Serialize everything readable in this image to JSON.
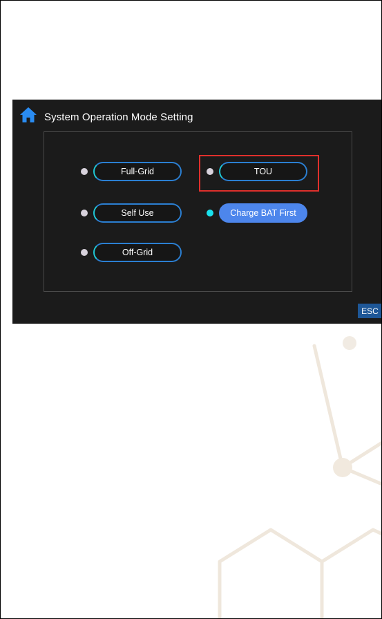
{
  "screen": {
    "title": "System Operation Mode Setting",
    "home_icon": "home-icon",
    "esc_label": "ESC"
  },
  "modes": {
    "full_grid": {
      "label": "Full-Grid",
      "selected": false
    },
    "tou": {
      "label": "TOU",
      "selected": false,
      "highlighted": true
    },
    "self_use": {
      "label": "Self Use",
      "selected": false
    },
    "charge_bat_first": {
      "label": "Charge BAT First",
      "selected": true
    },
    "off_grid": {
      "label": "Off-Grid",
      "selected": false
    }
  },
  "colors": {
    "screen_background": "#1b1b1b",
    "button_border": "#2b7fd2",
    "selected_button": "#4d86ec",
    "active_dot": "#19e2ee",
    "inactive_dot": "#d8d2dc",
    "highlight": "#e0302c",
    "esc_background": "#1e5797",
    "home_icon": "#2a8cf2"
  }
}
